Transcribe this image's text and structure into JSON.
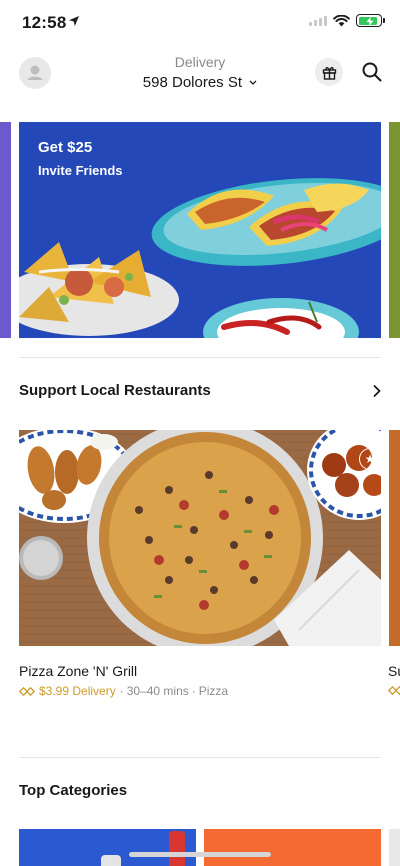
{
  "status_bar": {
    "time": "12:58",
    "icons": [
      "location-arrow-icon",
      "signal-icon",
      "wifi-icon",
      "battery-charging-icon"
    ],
    "battery_color": "#34c759",
    "battery_level_fraction": 0.9
  },
  "header": {
    "mode_label": "Delivery",
    "address": "598 Dolores St",
    "icons": [
      "avatar-icon",
      "chevron-down-icon",
      "gift-icon",
      "search-icon"
    ]
  },
  "promo": {
    "title": "Get $25",
    "subtitle": "Invite Friends",
    "background_color": "#2448b8"
  },
  "sections": {
    "support_local": {
      "title": "Support Local Restaurants",
      "arrow_icon": "chevron-right-icon"
    },
    "top_categories": {
      "title": "Top Categories"
    }
  },
  "stores": [
    {
      "name": "Pizza Zone 'N' Grill",
      "delivery_fee": "$3.99 Delivery",
      "separator": "·",
      "eta": "30–40 mins",
      "cuisine": "Pizza",
      "fee_icon": "diamond-fee-icon",
      "favorite_icon": "star-badge-icon"
    },
    {
      "name": "Su",
      "fee_icon": "diamond-fee-icon"
    }
  ],
  "colors": {
    "accent_fee": "#cc9b2b",
    "secondary_text": "#8a8a8a",
    "primary_text": "#191919"
  }
}
